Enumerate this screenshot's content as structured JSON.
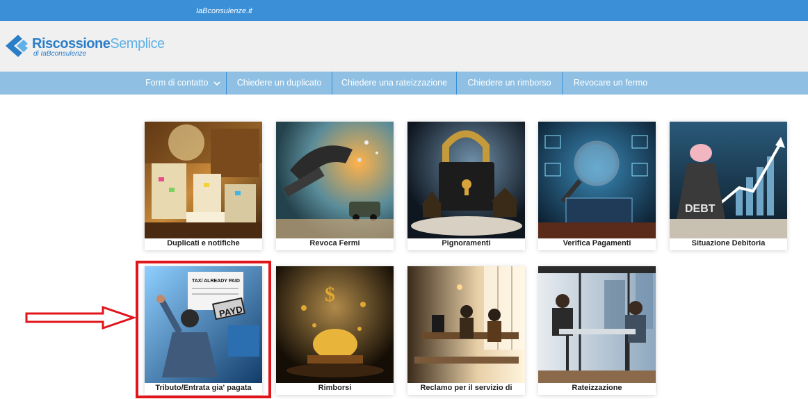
{
  "topbar": {
    "brand": "IaBconsulenze.it"
  },
  "logo": {
    "name_part1": "Riscossione",
    "name_part2": "Semplice",
    "subtitle": "di IaBconsulenze"
  },
  "nav": {
    "items": [
      {
        "label": "Form di contatto",
        "icon": "chevron-down-icon"
      },
      {
        "label": "Chiedere un duplicato"
      },
      {
        "label": "Chiedere una rateizzazione"
      },
      {
        "label": "Chiedere un rimborso"
      },
      {
        "label": "Revocare un fermo"
      }
    ]
  },
  "cards": [
    {
      "caption": "Duplicati e notifiche"
    },
    {
      "caption": "Revoca Fermi"
    },
    {
      "caption": "Pignoramenti"
    },
    {
      "caption": "Verifica Pagamenti"
    },
    {
      "caption": "Situazione Debitoria"
    },
    {
      "caption": "Tributo/Entrata gia' pagata"
    },
    {
      "caption": "Rimborsi"
    },
    {
      "caption": "Reclamo per il servizio di"
    },
    {
      "caption": "Rateizzazione"
    }
  ],
  "image_text": {
    "debt": "DEBT",
    "tax_paid": "TAX/ ALREADY PAID",
    "paid_stamp": "PAYD",
    "dollar": "$"
  },
  "colors": {
    "topbar": "#3a8fd6",
    "nav": "#8fc0e3",
    "highlight": "#e0161b"
  }
}
